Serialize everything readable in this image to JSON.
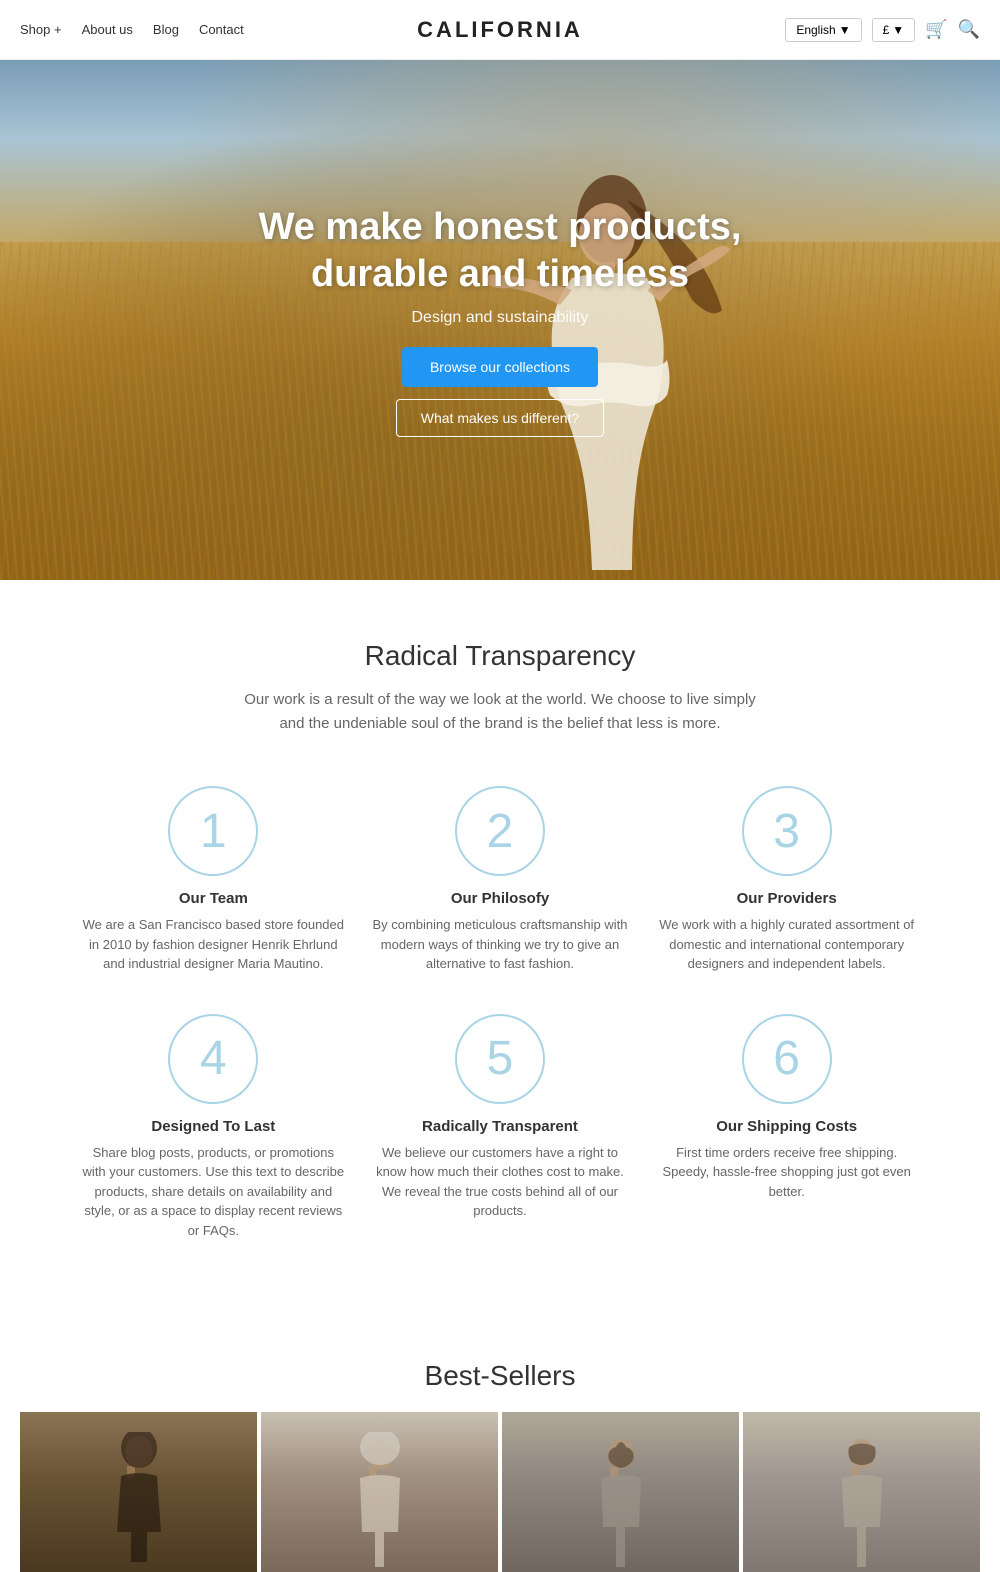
{
  "header": {
    "logo": "CALIFORNIA",
    "nav": [
      {
        "label": "Shop +",
        "id": "shop"
      },
      {
        "label": "About us",
        "id": "about"
      },
      {
        "label": "Blog",
        "id": "blog"
      },
      {
        "label": "Contact",
        "id": "contact"
      }
    ],
    "language": "English",
    "currency": "£",
    "cart_icon": "🛒",
    "search_icon": "🔍"
  },
  "hero": {
    "title": "We make honest products,\ndurable and timeless",
    "subtitle": "Design and sustainability",
    "cta_primary": "Browse our collections",
    "cta_secondary": "What makes us different?"
  },
  "transparency": {
    "title": "Radical Transparency",
    "description": "Our work is a result of the way we look at the world. We choose to live simply and the undeniable soul of the brand is the belief that less is more.",
    "features": [
      {
        "number": "1",
        "name": "Our Team",
        "description": "We are a San Francisco based store founded in 2010 by fashion designer Henrik Ehrlund and industrial designer Maria Mautino."
      },
      {
        "number": "2",
        "name": "Our Philosofy",
        "description": "By combining meticulous craftsmanship with modern ways of thinking we try to give an alternative to fast fashion."
      },
      {
        "number": "3",
        "name": "Our Providers",
        "description": "We work with a highly curated assortment of domestic and international contemporary designers and independent labels."
      },
      {
        "number": "4",
        "name": "Designed To Last",
        "description": "Share blog posts, products, or promotions with your customers. Use this text to describe products, share details on availability and style, or as a space to display recent reviews or FAQs."
      },
      {
        "number": "5",
        "name": "Radically Transparent",
        "description": "We believe our customers have a right to know how much their clothes cost to make. We reveal the true costs behind all of our products."
      },
      {
        "number": "6",
        "name": "Our Shipping Costs",
        "description": "First time orders receive free shipping. Speedy, hassle-free shopping just got even better."
      }
    ]
  },
  "bestsellers": {
    "title": "Best-Sellers",
    "products": [
      {
        "id": 1,
        "style": "dark"
      },
      {
        "id": 2,
        "style": "light-warm"
      },
      {
        "id": 3,
        "style": "mid"
      },
      {
        "id": 4,
        "style": "light"
      }
    ]
  }
}
